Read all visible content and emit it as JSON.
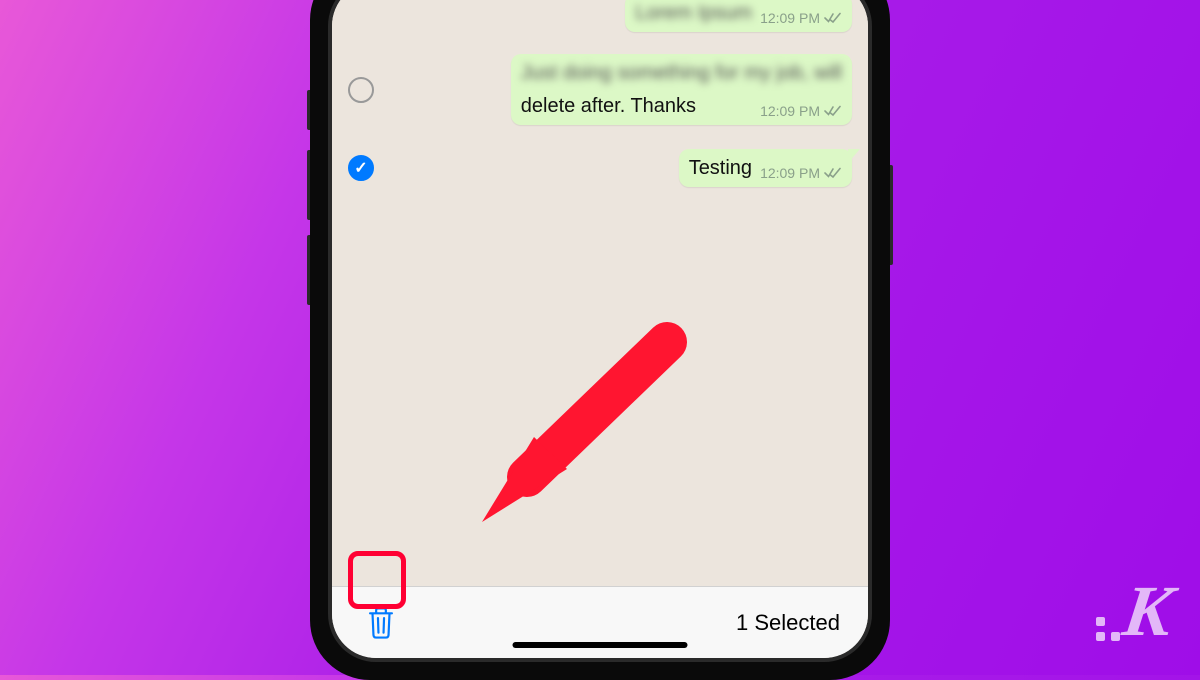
{
  "messages": [
    {
      "selected": false,
      "time": "12:09 PM",
      "blurred_preview": "Lorem Ipsum",
      "clear_text": null
    },
    {
      "selected": false,
      "time": "12:09 PM",
      "blurred_preview": "Just doing something for my job, will",
      "clear_text": "delete after. Thanks"
    },
    {
      "selected": true,
      "time": "12:09 PM",
      "blurred_preview": null,
      "clear_text": "Testing"
    }
  ],
  "toolbar": {
    "selected_count_label": "1 Selected"
  },
  "annotations": {
    "highlight_target": "trash-button",
    "arrow_points_to": "trash-button"
  },
  "colors": {
    "bubble": "#dcf8c6",
    "chat_bg": "#ece5dd",
    "accent_blue": "#007aff",
    "highlight_red": "#ff0033"
  }
}
